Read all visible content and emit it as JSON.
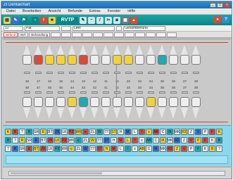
{
  "window": {
    "title": "ZI Dentalchart"
  },
  "menu": [
    "Datei",
    "Bearbeiten",
    "Ansicht",
    "Befunde",
    "Extras",
    "Fenster",
    "Hilfe"
  ],
  "toolbar_text": "RVTP",
  "fields": [
    "12",
    "Pat",
    "",
    "Leer",
    "",
    "Gesamtbefund"
  ],
  "tabs": [
    "Befund",
    "Bef.",
    "Behandlung",
    "",
    "",
    "",
    "",
    "",
    "",
    "",
    "",
    "",
    "",
    "",
    "",
    "",
    "",
    "",
    "",
    ""
  ],
  "numbers_upper": [
    "18",
    "17",
    "16",
    "15",
    "14",
    "13",
    "12",
    "11",
    "21",
    "22",
    "23",
    "24",
    "25",
    "26",
    "27",
    "28"
  ],
  "numbers_lower": [
    "48",
    "47",
    "46",
    "45",
    "44",
    "43",
    "42",
    "41",
    "31",
    "32",
    "33",
    "34",
    "35",
    "36",
    "37",
    "38"
  ],
  "symbol_labels": [
    "K",
    "B",
    "?",
    "R",
    "SR",
    "E",
    "BT",
    "ZK",
    "LK",
    "PZ",
    "WK",
    "e",
    "ZL",
    "W",
    "TT",
    "ST",
    "H",
    "M",
    "L",
    "f",
    "x",
    "AB",
    "C",
    "IK",
    "MK",
    "R2",
    "Z",
    "V",
    "P",
    "F"
  ],
  "colors": {
    "toolbar": "#0c8585",
    "chart_bg": "#c9c9c9",
    "symbols_bg": "#88d8ee",
    "red": "#c24a3a",
    "yellow": "#f2d23a",
    "teal": "#20a9b0"
  }
}
